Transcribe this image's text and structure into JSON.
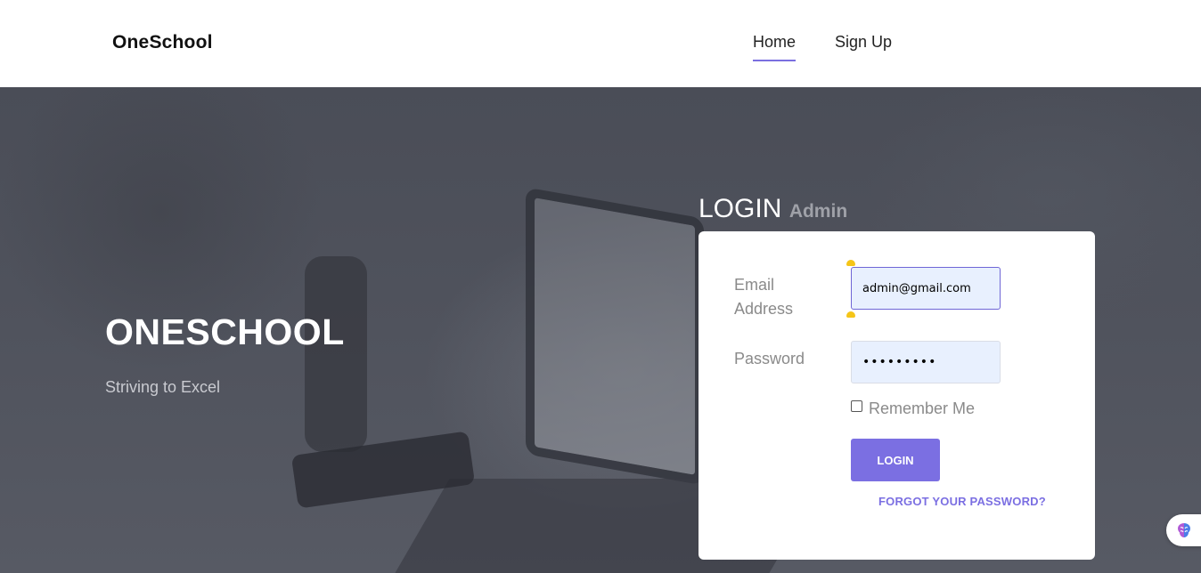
{
  "header": {
    "brand": "OneSchool",
    "nav": [
      {
        "label": "Home",
        "active": true
      },
      {
        "label": "Sign Up",
        "active": false
      }
    ]
  },
  "hero": {
    "title": "ONESCHOOL",
    "subtitle": "Striving to Excel"
  },
  "login": {
    "heading": "LOGIN",
    "role": "Admin",
    "email_label": "Email Address",
    "email_value": "admin@gmail.com",
    "password_label": "Password",
    "password_value": "•••••••••",
    "remember_label": "Remember Me",
    "remember_checked": false,
    "submit_label": "LOGIN",
    "forgot_label": "FORGOT YOUR PASSWORD?"
  },
  "colors": {
    "accent": "#7b6fe2",
    "hero_overlay": "#4f525c",
    "autofill": "#e8f0fe"
  },
  "icons": {
    "widget": "brain-icon",
    "input_handle": "drag-handle-icon"
  }
}
